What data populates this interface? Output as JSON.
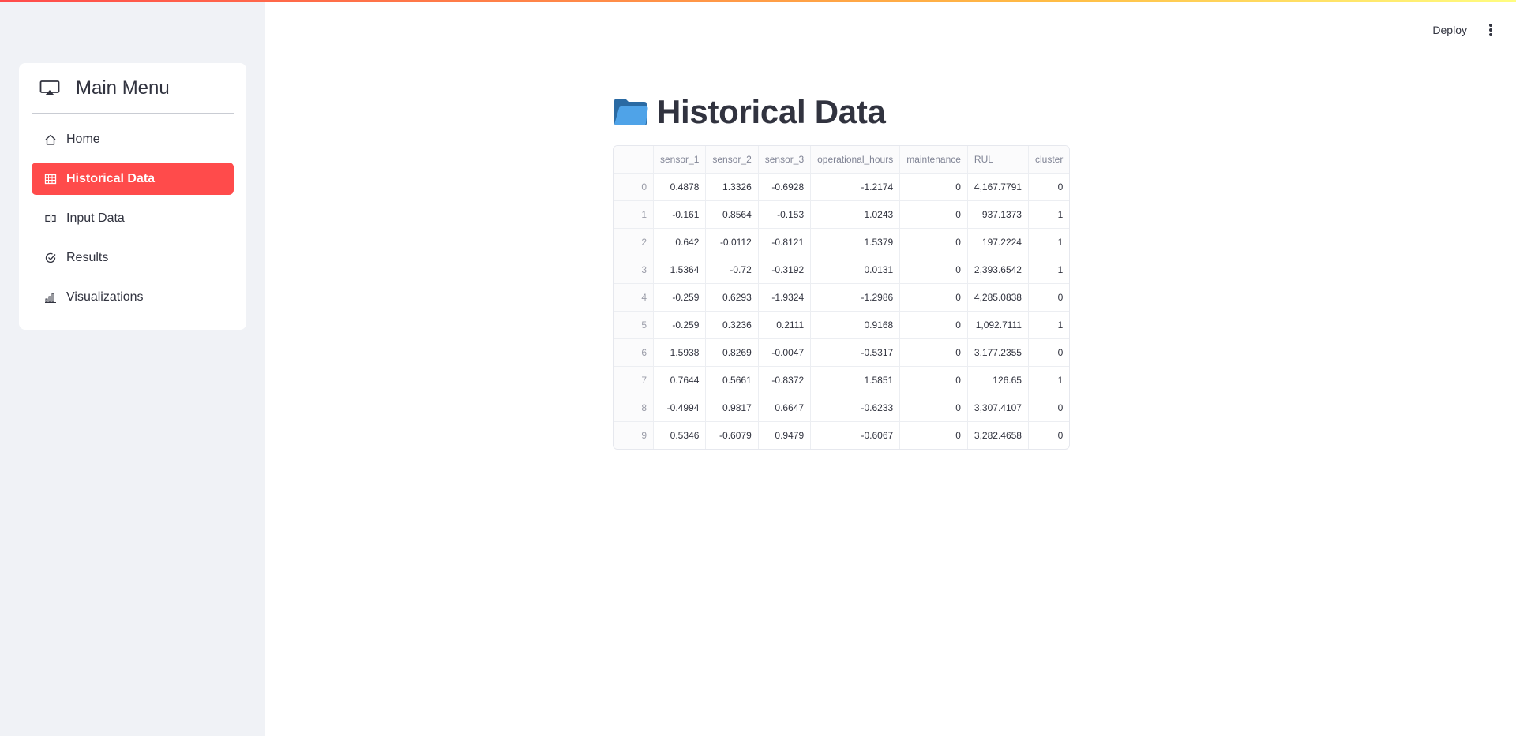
{
  "header": {
    "deploy_label": "Deploy"
  },
  "sidebar": {
    "title": "Main Menu",
    "items": [
      {
        "label": "Home",
        "icon": "house-icon",
        "active": false
      },
      {
        "label": "Historical Data",
        "icon": "table-icon",
        "active": true
      },
      {
        "label": "Input Data",
        "icon": "input-cursor-icon",
        "active": false
      },
      {
        "label": "Results",
        "icon": "check-circle-icon",
        "active": false
      },
      {
        "label": "Visualizations",
        "icon": "bar-chart-icon",
        "active": false
      }
    ]
  },
  "main": {
    "title": "Historical Data",
    "title_icon": "folder-icon"
  },
  "table": {
    "columns": [
      "",
      "sensor_1",
      "sensor_2",
      "sensor_3",
      "operational_hours",
      "maintenance",
      "RUL",
      "cluster"
    ],
    "rows": [
      [
        "0",
        "0.4878",
        "1.3326",
        "-0.6928",
        "-1.2174",
        "0",
        "4,167.7791",
        "0"
      ],
      [
        "1",
        "-0.161",
        "0.8564",
        "-0.153",
        "1.0243",
        "0",
        "937.1373",
        "1"
      ],
      [
        "2",
        "0.642",
        "-0.0112",
        "-0.8121",
        "1.5379",
        "0",
        "197.2224",
        "1"
      ],
      [
        "3",
        "1.5364",
        "-0.72",
        "-0.3192",
        "0.0131",
        "0",
        "2,393.6542",
        "1"
      ],
      [
        "4",
        "-0.259",
        "0.6293",
        "-1.9324",
        "-1.2986",
        "0",
        "4,285.0838",
        "0"
      ],
      [
        "5",
        "-0.259",
        "0.3236",
        "0.2111",
        "0.9168",
        "0",
        "1,092.7111",
        "1"
      ],
      [
        "6",
        "1.5938",
        "0.8269",
        "-0.0047",
        "-0.5317",
        "0",
        "3,177.2355",
        "0"
      ],
      [
        "7",
        "0.7644",
        "0.5661",
        "-0.8372",
        "1.5851",
        "0",
        "126.65",
        "1"
      ],
      [
        "8",
        "-0.4994",
        "0.9817",
        "0.6647",
        "-0.6233",
        "0",
        "3,307.4107",
        "0"
      ],
      [
        "9",
        "0.5346",
        "-0.6079",
        "0.9479",
        "-0.6067",
        "0",
        "3,282.4658",
        "0"
      ]
    ]
  },
  "colors": {
    "accent": "#ff4b4b",
    "sidebar_bg": "#f0f2f6",
    "folder_dark": "#2a6aa3",
    "folder_light": "#4fa3e8"
  }
}
